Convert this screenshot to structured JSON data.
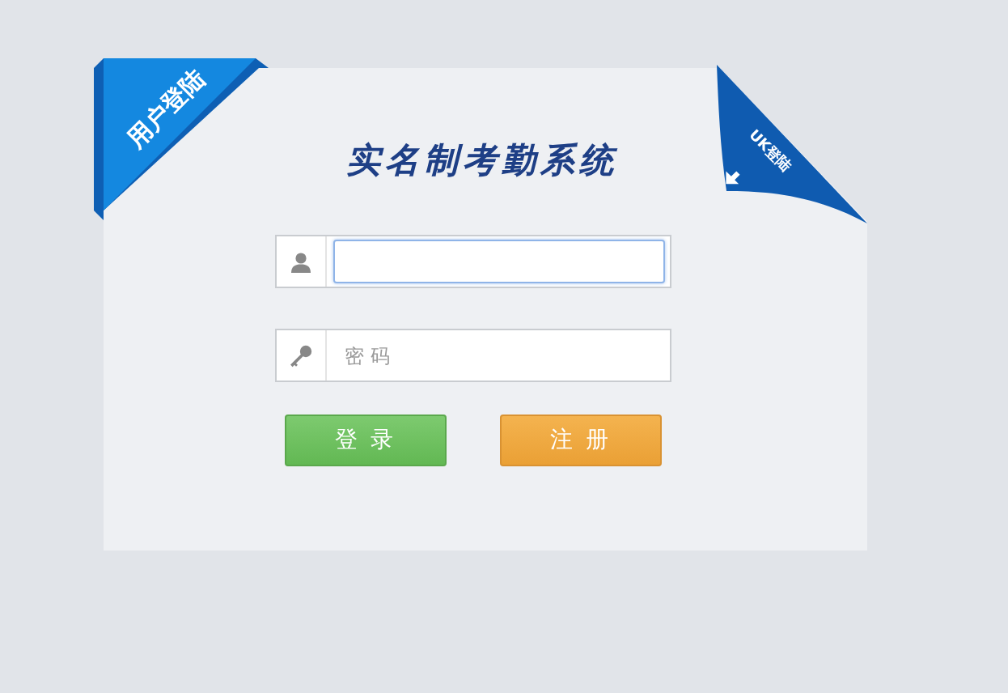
{
  "ribbon_left": {
    "label": "用户登陆"
  },
  "ribbon_right": {
    "label": "UK登陆"
  },
  "title": "实名制考勤系统",
  "fields": [
    {
      "kind": "user",
      "focused": true
    },
    {
      "kind": "password",
      "placeholder": "密 码",
      "focused": false
    }
  ],
  "buttons": [
    {
      "label": "登 录",
      "kind": "primary"
    },
    {
      "label": "注 册",
      "kind": "secondary"
    }
  ]
}
